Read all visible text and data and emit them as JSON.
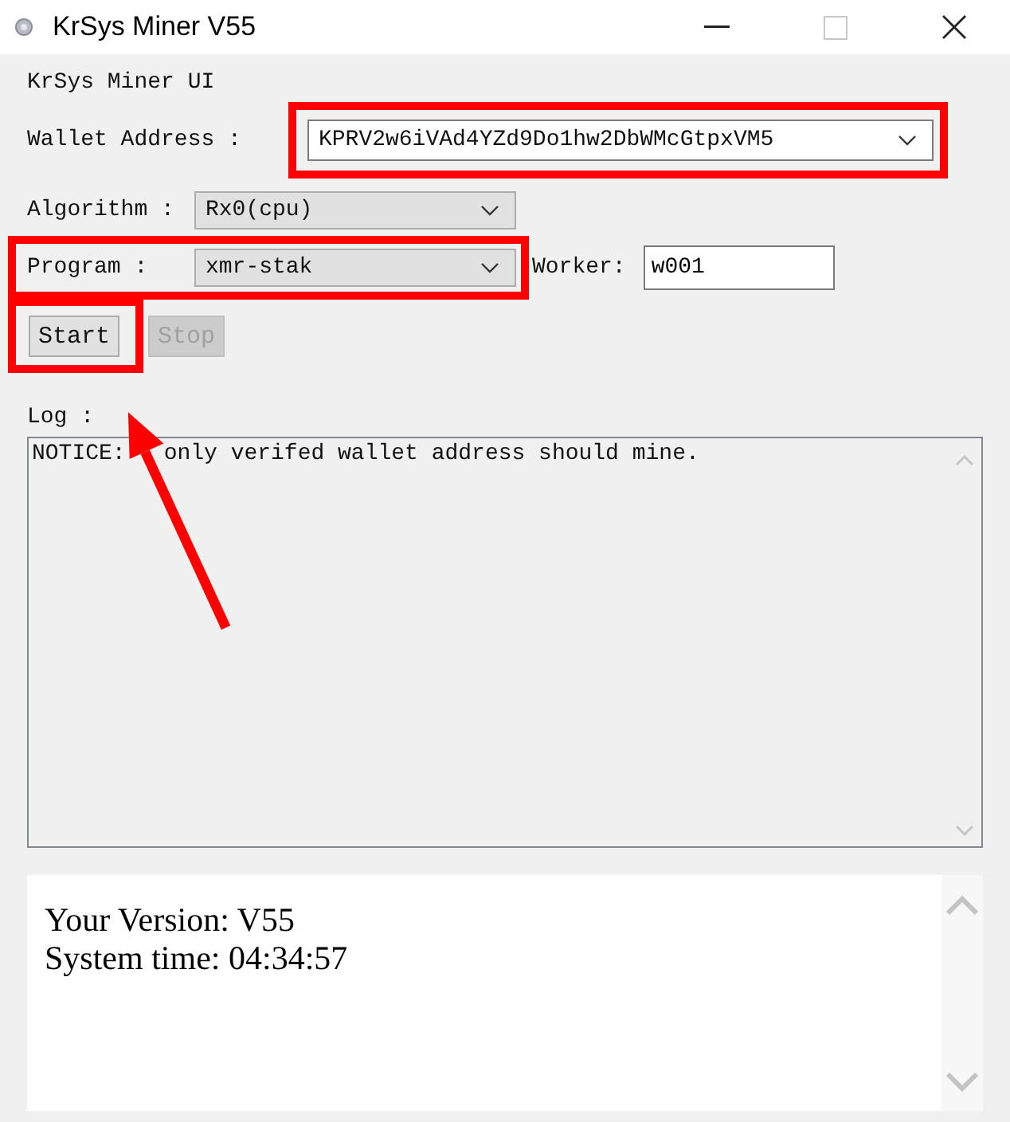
{
  "window": {
    "title": "KrSys Miner V55"
  },
  "header": "KrSys Miner UI",
  "wallet": {
    "label": "Wallet Address :",
    "value": "KPRV2w6iVAd4YZd9Do1hw2DbWMcGtpxVM5",
    "highlighted": true
  },
  "algorithm": {
    "label": "Algorithm :",
    "value": "Rx0(cpu)",
    "highlighted": false
  },
  "program": {
    "label": "Program :",
    "value": "xmr-stak",
    "highlighted": true
  },
  "worker": {
    "label": "Worker:",
    "value": "w001"
  },
  "buttons": [
    {
      "label": "Start",
      "disabled": false,
      "highlighted": true
    },
    {
      "label": "Stop",
      "disabled": true,
      "highlighted": false
    }
  ],
  "log": {
    "label": "Log :",
    "prefix": "NOTICE:",
    "text": "only verifed wallet address should mine.",
    "arrow": true
  },
  "info": {
    "lines": [
      "Your Version: V55",
      "System time: 04:34:57"
    ]
  }
}
